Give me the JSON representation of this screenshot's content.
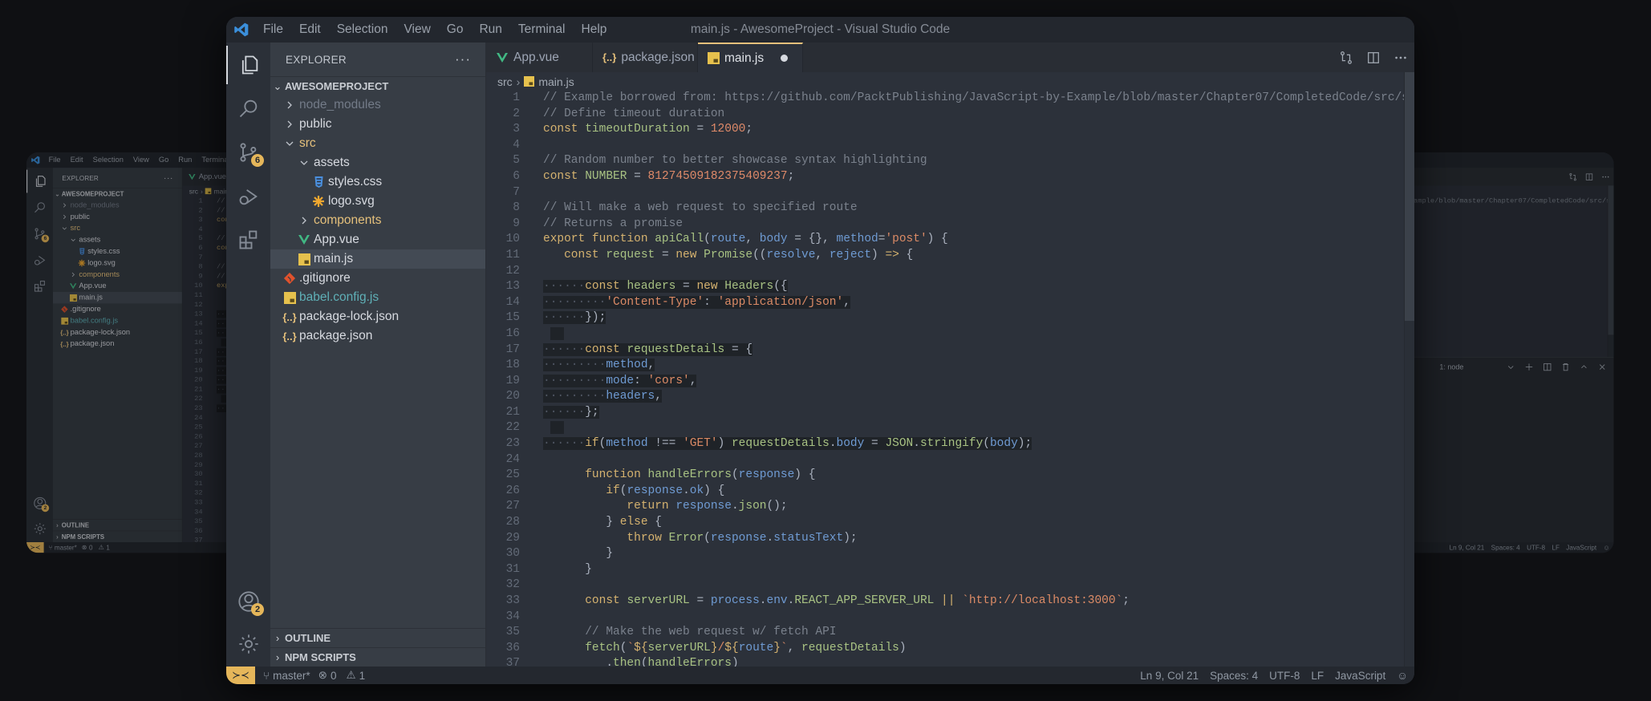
{
  "window": {
    "title": "main.js - AwesomeProject - Visual Studio Code"
  },
  "menu": [
    "File",
    "Edit",
    "Selection",
    "View",
    "Go",
    "Run",
    "Terminal",
    "Help"
  ],
  "activity": {
    "scm_badge": "6",
    "account_badge": "2"
  },
  "sidebar": {
    "header": "EXPLORER",
    "more": "···",
    "project": "AWESOMEPROJECT",
    "tree": [
      {
        "label": "node_modules",
        "level": 0,
        "kind": "folder",
        "open": false,
        "color": "#737b88"
      },
      {
        "label": "public",
        "level": 0,
        "kind": "folder",
        "open": false,
        "color": "#d7dae0"
      },
      {
        "label": "src",
        "level": 0,
        "kind": "folder",
        "open": true,
        "color": "#e5c07b"
      },
      {
        "label": "assets",
        "level": 1,
        "kind": "folder",
        "open": true,
        "color": "#d7dae0"
      },
      {
        "label": "styles.css",
        "level": 2,
        "kind": "file",
        "icon": "css-icon",
        "color": "#d7dae0"
      },
      {
        "label": "logo.svg",
        "level": 2,
        "kind": "file",
        "icon": "svg-icon",
        "color": "#d7dae0"
      },
      {
        "label": "components",
        "level": 1,
        "kind": "folder",
        "open": false,
        "color": "#e5c07b"
      },
      {
        "label": "App.vue",
        "level": 1,
        "kind": "file",
        "icon": "vue-icon",
        "color": "#d7dae0"
      },
      {
        "label": "main.js",
        "level": 1,
        "kind": "file",
        "icon": "js-icon",
        "color": "#d7dae0",
        "selected": true
      },
      {
        "label": ".gitignore",
        "level": 0,
        "kind": "file",
        "icon": "git-icon",
        "color": "#d7dae0"
      },
      {
        "label": "babel.config.js",
        "level": 0,
        "kind": "file",
        "icon": "js-icon",
        "color": "#5fb0b7"
      },
      {
        "label": "package-lock.json",
        "level": 0,
        "kind": "file",
        "icon": "json-icon",
        "color": "#d7dae0"
      },
      {
        "label": "package.json",
        "level": 0,
        "kind": "file",
        "icon": "json-icon",
        "color": "#d7dae0"
      }
    ],
    "outline": "OUTLINE",
    "npm": "NPM SCRIPTS"
  },
  "icons": {
    "json_glyph": "{..}",
    "vue_glyph": "V"
  },
  "tabs": [
    {
      "label": "App.vue",
      "icon": "vue-icon",
      "active": false
    },
    {
      "label": "package.json",
      "icon": "json-icon",
      "active": false
    },
    {
      "label": "main.js",
      "icon": "js-icon",
      "active": true,
      "modified": true
    }
  ],
  "breadcrumb": {
    "folder": "src",
    "file": "main.js"
  },
  "code": [
    {
      "i": 0,
      "t": [
        [
          "c",
          "// Example borrowed from: https://github.com/PacktPublishing/JavaScript-by-Example/blob/master/Chapter07/CompletedCode/src/se"
        ]
      ]
    },
    {
      "i": 0,
      "t": [
        [
          "c",
          "// Define timeout duration"
        ]
      ]
    },
    {
      "i": 0,
      "t": [
        [
          "k",
          "const"
        ],
        [
          "t",
          " "
        ],
        [
          "f",
          "timeoutDuration"
        ],
        [
          "t",
          " = "
        ],
        [
          "n",
          "12000"
        ],
        [
          "t",
          ";"
        ]
      ]
    },
    {
      "i": 0,
      "t": []
    },
    {
      "i": 0,
      "t": [
        [
          "c",
          "// Random number to better showcase syntax highlighting"
        ]
      ]
    },
    {
      "i": 0,
      "t": [
        [
          "k",
          "const"
        ],
        [
          "t",
          " "
        ],
        [
          "f",
          "NUMBER"
        ],
        [
          "t",
          " = "
        ],
        [
          "n",
          "81274509182375409237"
        ],
        [
          "t",
          ";"
        ]
      ]
    },
    {
      "i": 0,
      "t": []
    },
    {
      "i": 0,
      "t": [
        [
          "c",
          "// Will make a web request to specified route"
        ]
      ]
    },
    {
      "i": 0,
      "t": [
        [
          "c",
          "// Returns a promise"
        ]
      ]
    },
    {
      "i": 0,
      "t": [
        [
          "k",
          "export function"
        ],
        [
          "t",
          " "
        ],
        [
          "f",
          "apiCall"
        ],
        [
          "t",
          "("
        ],
        [
          "p",
          "route"
        ],
        [
          "t",
          ", "
        ],
        [
          "p",
          "body"
        ],
        [
          "t",
          " = {}, "
        ],
        [
          "p",
          "method"
        ],
        [
          "t",
          "="
        ],
        [
          "s",
          "'post'"
        ],
        [
          "t",
          ") {"
        ]
      ]
    },
    {
      "i": 3,
      "t": [
        [
          "k",
          "const"
        ],
        [
          "t",
          " "
        ],
        [
          "f",
          "request"
        ],
        [
          "t",
          " = "
        ],
        [
          "k",
          "new"
        ],
        [
          "t",
          " "
        ],
        [
          "f",
          "Promise"
        ],
        [
          "t",
          "(("
        ],
        [
          "p",
          "resolve"
        ],
        [
          "t",
          ", "
        ],
        [
          "p",
          "reject"
        ],
        [
          "t",
          ") "
        ],
        [
          "k",
          "=>"
        ],
        [
          "t",
          " {"
        ]
      ]
    },
    {
      "i": 0,
      "t": []
    },
    {
      "i": 6,
      "sel": true,
      "t": [
        [
          "k",
          "const"
        ],
        [
          "t",
          " "
        ],
        [
          "f",
          "headers"
        ],
        [
          "t",
          " = "
        ],
        [
          "k",
          "new"
        ],
        [
          "t",
          " "
        ],
        [
          "f",
          "Headers"
        ],
        [
          "t",
          "({"
        ]
      ]
    },
    {
      "i": 9,
      "sel": true,
      "t": [
        [
          "s",
          "'Content-Type'"
        ],
        [
          "t",
          ": "
        ],
        [
          "s",
          "'application/json'"
        ],
        [
          "t",
          ","
        ]
      ]
    },
    {
      "i": 6,
      "sel": true,
      "t": [
        [
          "t",
          "});"
        ]
      ]
    },
    {
      "i": 0,
      "sel": true,
      "empty": true,
      "t": []
    },
    {
      "i": 6,
      "sel": true,
      "t": [
        [
          "k",
          "const"
        ],
        [
          "t",
          " "
        ],
        [
          "f",
          "requestDetails"
        ],
        [
          "t",
          " = {"
        ]
      ]
    },
    {
      "i": 9,
      "sel": true,
      "t": [
        [
          "p",
          "method"
        ],
        [
          "t",
          ","
        ]
      ]
    },
    {
      "i": 9,
      "sel": true,
      "t": [
        [
          "p",
          "mode"
        ],
        [
          "t",
          ": "
        ],
        [
          "s",
          "'cors'"
        ],
        [
          "t",
          ","
        ]
      ]
    },
    {
      "i": 9,
      "sel": true,
      "t": [
        [
          "p",
          "headers"
        ],
        [
          "t",
          ","
        ]
      ]
    },
    {
      "i": 6,
      "sel": true,
      "t": [
        [
          "t",
          "};"
        ]
      ]
    },
    {
      "i": 0,
      "sel": true,
      "empty": true,
      "t": []
    },
    {
      "i": 6,
      "sel": true,
      "t": [
        [
          "k",
          "if"
        ],
        [
          "t",
          "("
        ],
        [
          "p",
          "method"
        ],
        [
          "t",
          " !== "
        ],
        [
          "s",
          "'GET'"
        ],
        [
          "t",
          ") "
        ],
        [
          "f",
          "requestDetails"
        ],
        [
          "t",
          "."
        ],
        [
          "p",
          "body"
        ],
        [
          "t",
          " = "
        ],
        [
          "f",
          "JSON"
        ],
        [
          "t",
          "."
        ],
        [
          "f",
          "stringify"
        ],
        [
          "t",
          "("
        ],
        [
          "p",
          "body"
        ],
        [
          "t",
          ");"
        ]
      ]
    },
    {
      "i": 0,
      "t": []
    },
    {
      "i": 6,
      "t": [
        [
          "k",
          "function"
        ],
        [
          "t",
          " "
        ],
        [
          "f",
          "handleErrors"
        ],
        [
          "t",
          "("
        ],
        [
          "p",
          "response"
        ],
        [
          "t",
          ") {"
        ]
      ]
    },
    {
      "i": 9,
      "t": [
        [
          "k",
          "if"
        ],
        [
          "t",
          "("
        ],
        [
          "p",
          "response"
        ],
        [
          "t",
          "."
        ],
        [
          "p",
          "ok"
        ],
        [
          "t",
          ") {"
        ]
      ]
    },
    {
      "i": 12,
      "t": [
        [
          "k",
          "return"
        ],
        [
          "t",
          " "
        ],
        [
          "p",
          "response"
        ],
        [
          "t",
          "."
        ],
        [
          "f",
          "json"
        ],
        [
          "t",
          "();"
        ]
      ]
    },
    {
      "i": 9,
      "t": [
        [
          "t",
          "} "
        ],
        [
          "k",
          "else"
        ],
        [
          "t",
          " {"
        ]
      ]
    },
    {
      "i": 12,
      "t": [
        [
          "k",
          "throw"
        ],
        [
          "t",
          " "
        ],
        [
          "f",
          "Error"
        ],
        [
          "t",
          "("
        ],
        [
          "p",
          "response"
        ],
        [
          "t",
          "."
        ],
        [
          "p",
          "statusText"
        ],
        [
          "t",
          ");"
        ]
      ]
    },
    {
      "i": 9,
      "t": [
        [
          "t",
          "}"
        ]
      ]
    },
    {
      "i": 6,
      "t": [
        [
          "t",
          "}"
        ]
      ]
    },
    {
      "i": 0,
      "t": []
    },
    {
      "i": 6,
      "t": [
        [
          "k",
          "const"
        ],
        [
          "t",
          " "
        ],
        [
          "f",
          "serverURL"
        ],
        [
          "t",
          " = "
        ],
        [
          "p",
          "process"
        ],
        [
          "t",
          "."
        ],
        [
          "p",
          "env"
        ],
        [
          "t",
          "."
        ],
        [
          "f",
          "REACT_APP_SERVER_URL"
        ],
        [
          "t",
          " "
        ],
        [
          "k",
          "||"
        ],
        [
          "t",
          " "
        ],
        [
          "s",
          "`http://localhost:3000`"
        ],
        [
          "t",
          ";"
        ]
      ]
    },
    {
      "i": 0,
      "t": []
    },
    {
      "i": 6,
      "t": [
        [
          "c",
          "// Make the web request w/ fetch API"
        ]
      ]
    },
    {
      "i": 6,
      "t": [
        [
          "f",
          "fetch"
        ],
        [
          "t",
          "("
        ],
        [
          "s",
          "`"
        ],
        [
          "k",
          "${"
        ],
        [
          "f",
          "serverURL"
        ],
        [
          "k",
          "}"
        ],
        [
          "s",
          "/"
        ],
        [
          "k",
          "${"
        ],
        [
          "p",
          "route"
        ],
        [
          "k",
          "}"
        ],
        [
          "s",
          "`"
        ],
        [
          "t",
          ", "
        ],
        [
          "f",
          "requestDetails"
        ],
        [
          "t",
          ")"
        ]
      ]
    },
    {
      "i": 9,
      "t": [
        [
          "t",
          "."
        ],
        [
          "f",
          "then"
        ],
        [
          "t",
          "("
        ],
        [
          "f",
          "handleErrors"
        ],
        [
          "t",
          ")"
        ]
      ]
    }
  ],
  "terminal": {
    "select": "1: node"
  },
  "status": {
    "branch": "master*",
    "errors": "0",
    "warnings": "1",
    "position": "Ln 9, Col 21",
    "spaces": "Spaces: 4",
    "encoding": "UTF-8",
    "eol": "LF",
    "language": "JavaScript"
  },
  "colors": {
    "accent": "#e5b65a",
    "modified_folder": "#e5c07b"
  }
}
